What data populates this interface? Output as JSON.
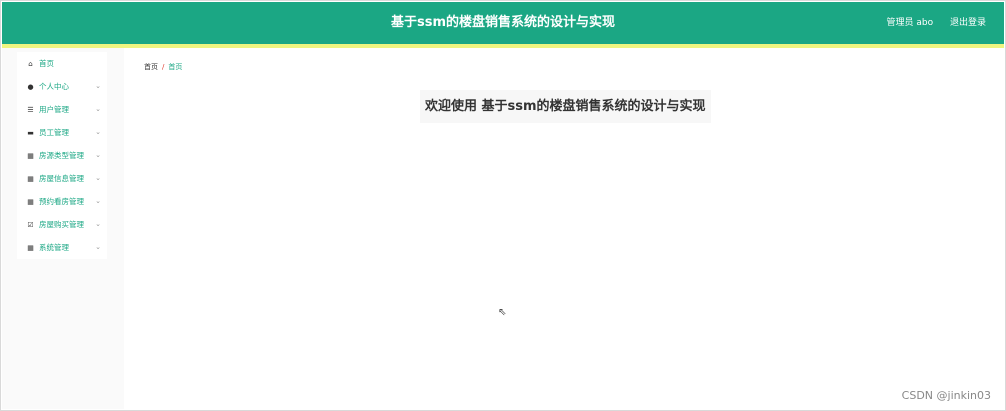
{
  "header": {
    "title": "基于ssm的楼盘销售系统的设计与实现",
    "admin_label": "管理员 abo",
    "logout_label": "退出登录",
    "colors": {
      "bar": "#1ba784",
      "strip": "#eef580"
    }
  },
  "sidebar": {
    "items": [
      {
        "label": "首页",
        "icon": "home-icon"
      },
      {
        "label": "个人中心",
        "icon": "user-icon"
      },
      {
        "label": "用户管理",
        "icon": "sliders-icon"
      },
      {
        "label": "员工管理",
        "icon": "briefcase-icon"
      },
      {
        "label": "房源类型管理",
        "icon": "grid-icon"
      },
      {
        "label": "房屋信息管理",
        "icon": "grid-icon"
      },
      {
        "label": "预约看房管理",
        "icon": "grid-icon"
      },
      {
        "label": "房屋购买管理",
        "icon": "check-square-icon"
      },
      {
        "label": "系统管理",
        "icon": "grid-icon"
      }
    ]
  },
  "breadcrumb": {
    "home": "首页",
    "separator": "/",
    "current": "首页"
  },
  "main": {
    "welcome": "欢迎使用 基于ssm的楼盘销售系统的设计与实现"
  },
  "watermark": "CSDN @jinkin03"
}
